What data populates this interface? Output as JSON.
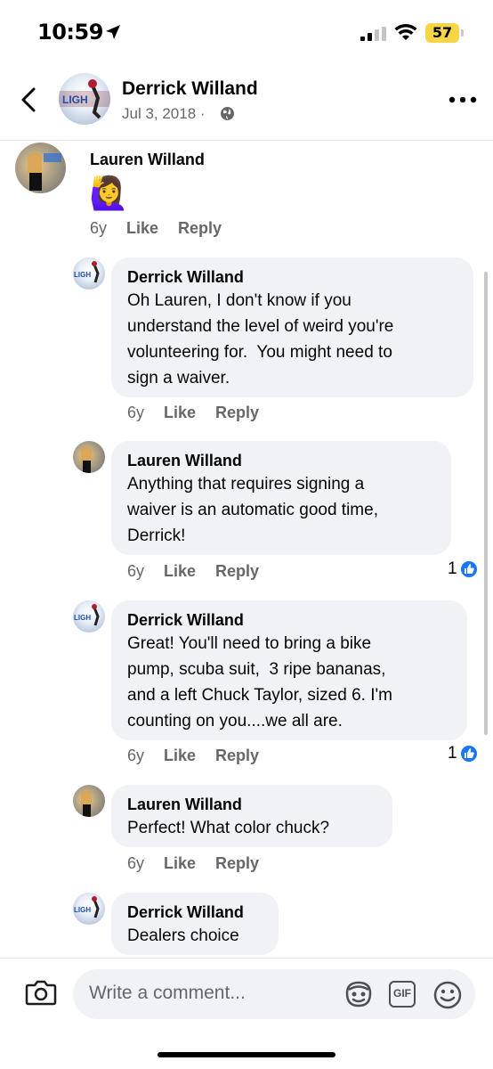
{
  "status_bar": {
    "time": "10:59",
    "battery": "57"
  },
  "header": {
    "name": "Derrick Willand",
    "date": "Jul 3, 2018 ·",
    "avatar_text": "LIGH"
  },
  "comments": [
    {
      "name": "Lauren Willand",
      "text": "🙋‍♀️",
      "age": "6y",
      "like": "Like",
      "reply": "Reply"
    },
    {
      "name": "Derrick Willand",
      "text": "Oh Lauren, I don't know if you\nunderstand the level of weird you're\nvolunteering for.  You might need to\nsign a waiver.",
      "age": "6y",
      "like": "Like",
      "reply": "Reply"
    },
    {
      "name": "Lauren Willand",
      "text": "Anything that requires signing a\nwaiver is an automatic good time,\nDerrick!",
      "age": "6y",
      "like": "Like",
      "reply": "Reply",
      "reactions": "1"
    },
    {
      "name": "Derrick Willand",
      "text": "Great! You'll need to bring a bike\npump, scuba suit,  3 ripe bananas,\nand a left Chuck Taylor, sized 6. I'm\ncounting on you....we all are.",
      "age": "6y",
      "like": "Like",
      "reply": "Reply",
      "reactions": "1"
    },
    {
      "name": "Lauren Willand",
      "text": "Perfect! What color chuck?",
      "age": "6y",
      "like": "Like",
      "reply": "Reply"
    },
    {
      "name": "Derrick Willand",
      "text": "Dealers choice"
    }
  ],
  "composer": {
    "placeholder": "Write a comment...",
    "gif_label": "GIF"
  },
  "colors": {
    "like_blue": "#1877f2",
    "bubble_bg": "#f0f2f5",
    "meta_gray": "#65676b"
  },
  "icons": [
    "location-arrow-icon",
    "signal-icon",
    "wifi-icon",
    "back-chevron-icon",
    "globe-icon",
    "more-icon",
    "camera-icon",
    "avatar-sticker-icon",
    "gif-icon",
    "emoji-icon",
    "like-icon"
  ]
}
